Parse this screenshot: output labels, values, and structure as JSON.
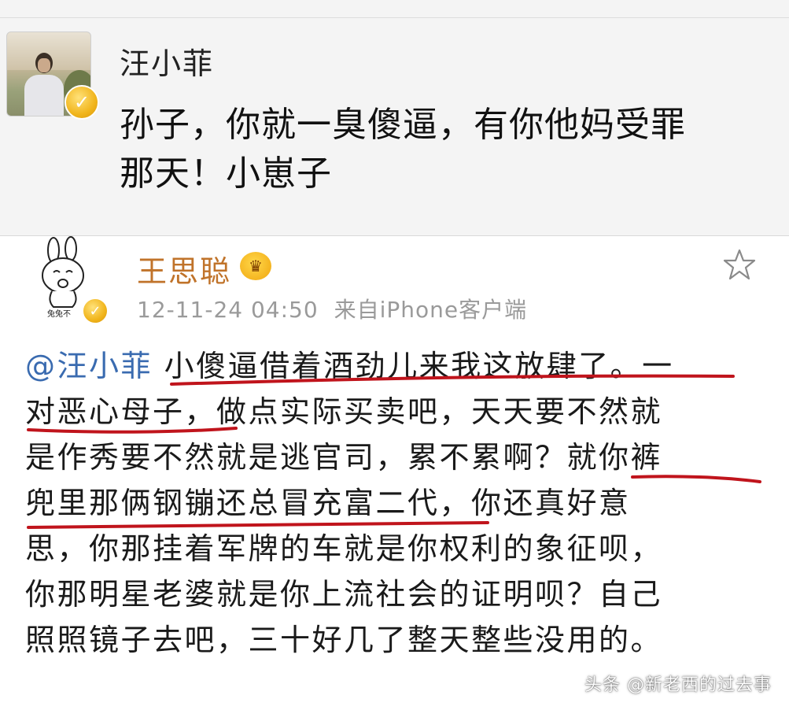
{
  "top_post": {
    "author": "汪小菲",
    "line1": "孙子，你就一臭傻逼，有你他妈受罪",
    "line2": "那天！小崽子",
    "verified_icon": "verified-v-badge"
  },
  "reply_post": {
    "author": "王思聪",
    "timestamp": "12-11-24 04:50",
    "source": "来自iPhone客户端",
    "avatar_caption": "兔兔不",
    "mention": "@汪小菲",
    "lines": [
      " 小傻逼借着酒劲儿来我这放肆了。一",
      "对恶心母子，做点实际买卖吧，天天要不然就",
      "是作秀要不然就是逃官司，累不累啊？就你裤",
      "兜里那俩钢镚还总冒充富二代，你还真好意",
      "思，你那挂着军牌的车就是你权利的象征呗，",
      "你那明星老婆就是你上流社会的证明呗？自己",
      "照照镜子去吧，三十好几了整天整些没用的。"
    ],
    "icons": [
      "crown-icon",
      "star-icon",
      "verified-v-badge"
    ],
    "underline_color": "#c0141c"
  },
  "watermark": "头条 @新老西的过去事"
}
